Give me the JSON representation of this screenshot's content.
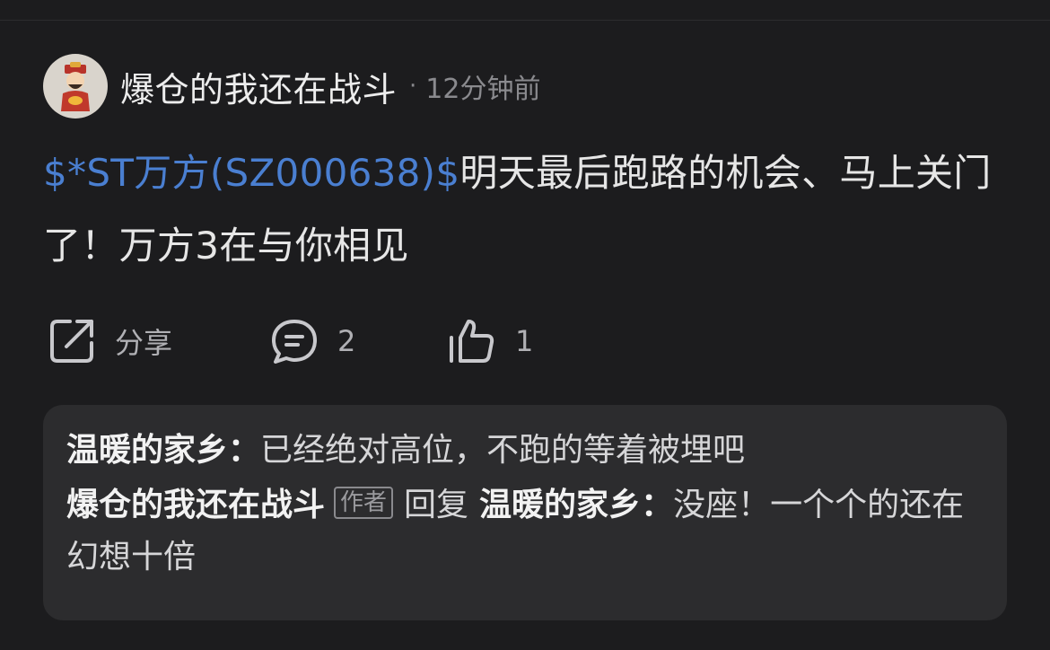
{
  "post": {
    "author": "爆仓的我还在战斗",
    "separator": "·",
    "time": "12分钟前",
    "avatar_icon": "caishen-avatar-icon",
    "stock_link": "$*ST万方(SZ000638)$",
    "text": "明天最后跑路的机会、马上关门了！万方3在与你相见"
  },
  "actions": {
    "share_label": "分享",
    "comment_count": "2",
    "like_count": "1",
    "share_icon": "share-icon",
    "comment_icon": "comment-icon",
    "like_icon": "thumbs-up-icon"
  },
  "replies": [
    {
      "name": "温暖的家乡",
      "colon": "：",
      "text": "已经绝对高位，不跑的等着被埋吧"
    },
    {
      "name": "爆仓的我还在战斗",
      "badge": "作者",
      "reply_word": "回复",
      "target": "温暖的家乡",
      "colon": "：",
      "text": "没座！一个个的还在幻想十倍"
    }
  ],
  "colors": {
    "background": "#1c1c1e",
    "reply_box": "#2c2c2e",
    "link": "#4a7fd1"
  }
}
